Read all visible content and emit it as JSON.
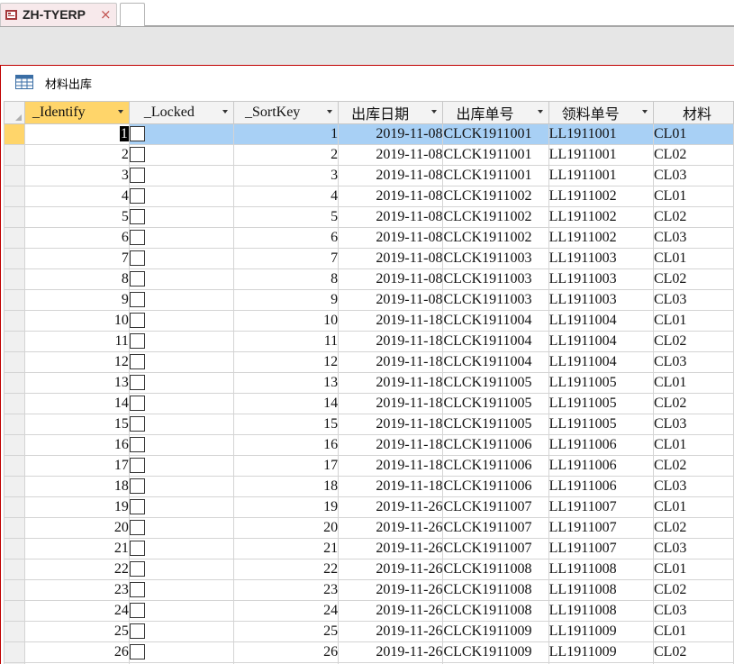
{
  "tabs": {
    "active_title": "ZH-TYERP",
    "close_symbol": "×"
  },
  "form": {
    "title": "材料出库"
  },
  "columns": [
    {
      "key": "identify",
      "label": "_Identify"
    },
    {
      "key": "locked",
      "label": "_Locked"
    },
    {
      "key": "sortkey",
      "label": "_SortKey"
    },
    {
      "key": "date",
      "label": "出库日期"
    },
    {
      "key": "out_no",
      "label": "出库单号"
    },
    {
      "key": "req_no",
      "label": "领料单号"
    },
    {
      "key": "material",
      "label": "材料"
    }
  ],
  "rows": [
    {
      "identify": "1",
      "locked": false,
      "sortkey": "1",
      "date": "2019-11-08",
      "out_no": "CLCK1911001",
      "req_no": "LL1911001",
      "material": "CL01"
    },
    {
      "identify": "2",
      "locked": false,
      "sortkey": "2",
      "date": "2019-11-08",
      "out_no": "CLCK1911001",
      "req_no": "LL1911001",
      "material": "CL02"
    },
    {
      "identify": "3",
      "locked": false,
      "sortkey": "3",
      "date": "2019-11-08",
      "out_no": "CLCK1911001",
      "req_no": "LL1911001",
      "material": "CL03"
    },
    {
      "identify": "4",
      "locked": false,
      "sortkey": "4",
      "date": "2019-11-08",
      "out_no": "CLCK1911002",
      "req_no": "LL1911002",
      "material": "CL01"
    },
    {
      "identify": "5",
      "locked": false,
      "sortkey": "5",
      "date": "2019-11-08",
      "out_no": "CLCK1911002",
      "req_no": "LL1911002",
      "material": "CL02"
    },
    {
      "identify": "6",
      "locked": false,
      "sortkey": "6",
      "date": "2019-11-08",
      "out_no": "CLCK1911002",
      "req_no": "LL1911002",
      "material": "CL03"
    },
    {
      "identify": "7",
      "locked": false,
      "sortkey": "7",
      "date": "2019-11-08",
      "out_no": "CLCK1911003",
      "req_no": "LL1911003",
      "material": "CL01"
    },
    {
      "identify": "8",
      "locked": false,
      "sortkey": "8",
      "date": "2019-11-08",
      "out_no": "CLCK1911003",
      "req_no": "LL1911003",
      "material": "CL02"
    },
    {
      "identify": "9",
      "locked": false,
      "sortkey": "9",
      "date": "2019-11-08",
      "out_no": "CLCK1911003",
      "req_no": "LL1911003",
      "material": "CL03"
    },
    {
      "identify": "10",
      "locked": false,
      "sortkey": "10",
      "date": "2019-11-18",
      "out_no": "CLCK1911004",
      "req_no": "LL1911004",
      "material": "CL01"
    },
    {
      "identify": "11",
      "locked": false,
      "sortkey": "11",
      "date": "2019-11-18",
      "out_no": "CLCK1911004",
      "req_no": "LL1911004",
      "material": "CL02"
    },
    {
      "identify": "12",
      "locked": false,
      "sortkey": "12",
      "date": "2019-11-18",
      "out_no": "CLCK1911004",
      "req_no": "LL1911004",
      "material": "CL03"
    },
    {
      "identify": "13",
      "locked": false,
      "sortkey": "13",
      "date": "2019-11-18",
      "out_no": "CLCK1911005",
      "req_no": "LL1911005",
      "material": "CL01"
    },
    {
      "identify": "14",
      "locked": false,
      "sortkey": "14",
      "date": "2019-11-18",
      "out_no": "CLCK1911005",
      "req_no": "LL1911005",
      "material": "CL02"
    },
    {
      "identify": "15",
      "locked": false,
      "sortkey": "15",
      "date": "2019-11-18",
      "out_no": "CLCK1911005",
      "req_no": "LL1911005",
      "material": "CL03"
    },
    {
      "identify": "16",
      "locked": false,
      "sortkey": "16",
      "date": "2019-11-18",
      "out_no": "CLCK1911006",
      "req_no": "LL1911006",
      "material": "CL01"
    },
    {
      "identify": "17",
      "locked": false,
      "sortkey": "17",
      "date": "2019-11-18",
      "out_no": "CLCK1911006",
      "req_no": "LL1911006",
      "material": "CL02"
    },
    {
      "identify": "18",
      "locked": false,
      "sortkey": "18",
      "date": "2019-11-18",
      "out_no": "CLCK1911006",
      "req_no": "LL1911006",
      "material": "CL03"
    },
    {
      "identify": "19",
      "locked": false,
      "sortkey": "19",
      "date": "2019-11-26",
      "out_no": "CLCK1911007",
      "req_no": "LL1911007",
      "material": "CL01"
    },
    {
      "identify": "20",
      "locked": false,
      "sortkey": "20",
      "date": "2019-11-26",
      "out_no": "CLCK1911007",
      "req_no": "LL1911007",
      "material": "CL02"
    },
    {
      "identify": "21",
      "locked": false,
      "sortkey": "21",
      "date": "2019-11-26",
      "out_no": "CLCK1911007",
      "req_no": "LL1911007",
      "material": "CL03"
    },
    {
      "identify": "22",
      "locked": false,
      "sortkey": "22",
      "date": "2019-11-26",
      "out_no": "CLCK1911008",
      "req_no": "LL1911008",
      "material": "CL01"
    },
    {
      "identify": "23",
      "locked": false,
      "sortkey": "23",
      "date": "2019-11-26",
      "out_no": "CLCK1911008",
      "req_no": "LL1911008",
      "material": "CL02"
    },
    {
      "identify": "24",
      "locked": false,
      "sortkey": "24",
      "date": "2019-11-26",
      "out_no": "CLCK1911008",
      "req_no": "LL1911008",
      "material": "CL03"
    },
    {
      "identify": "25",
      "locked": false,
      "sortkey": "25",
      "date": "2019-11-26",
      "out_no": "CLCK1911009",
      "req_no": "LL1911009",
      "material": "CL01"
    },
    {
      "identify": "26",
      "locked": false,
      "sortkey": "26",
      "date": "2019-11-26",
      "out_no": "CLCK1911009",
      "req_no": "LL1911009",
      "material": "CL02"
    },
    {
      "identify": "",
      "locked": false,
      "sortkey": "",
      "date": "",
      "out_no": "",
      "req_no": "",
      "material": ""
    }
  ],
  "current_row_index": 0,
  "colors": {
    "selected_row": "#a8d0f5",
    "header_active": "#ffd56a",
    "access_accent": "#c00000"
  }
}
